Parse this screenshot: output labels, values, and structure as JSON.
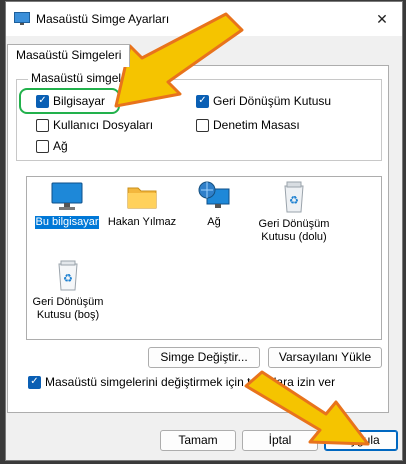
{
  "window": {
    "title": "Masaüstü Simge Ayarları",
    "close_glyph": "✕"
  },
  "tab": {
    "label": "Masaüstü Simgeleri"
  },
  "group": {
    "title": "Masaüstü simgeleri",
    "checkboxes": [
      {
        "label": "Bilgisayar",
        "checked": true
      },
      {
        "label": "Kullanıcı Dosyaları",
        "checked": false
      },
      {
        "label": "Ağ",
        "checked": false
      },
      {
        "label": "Geri Dönüşüm Kutusu",
        "checked": true
      },
      {
        "label": "Denetim Masası",
        "checked": false
      }
    ]
  },
  "icons": [
    {
      "label": "Bu bilgisayar",
      "icon": "monitor-icon",
      "selected": true
    },
    {
      "label": "Hakan Yılmaz",
      "icon": "folder-icon",
      "selected": false
    },
    {
      "label": "Ağ",
      "icon": "network-globe-icon",
      "selected": false
    },
    {
      "label_lines": [
        "Geri Dönüşüm",
        "Kutusu (dolu)"
      ],
      "icon": "recycle-bin-full-icon",
      "selected": false
    },
    {
      "label_lines": [
        "Geri Dönüşüm",
        "Kutusu (boş)"
      ],
      "icon": "recycle-bin-empty-icon",
      "selected": false
    }
  ],
  "buttons": {
    "change_icon": "Simge Değiştir...",
    "restore_default": "Varsayılanı Yükle",
    "ok": "Tamam",
    "cancel": "İptal",
    "apply": "Uygula"
  },
  "theme_checkbox": {
    "label": "Masaüstü simgelerini değiştirmek için temalara izin ver",
    "checked": true
  },
  "colors": {
    "accent": "#0a5fb4",
    "selection": "#0078d7",
    "highlight_ring": "#22b14c",
    "arrow_fill": "#f5c400",
    "arrow_stroke": "#e8731c"
  }
}
